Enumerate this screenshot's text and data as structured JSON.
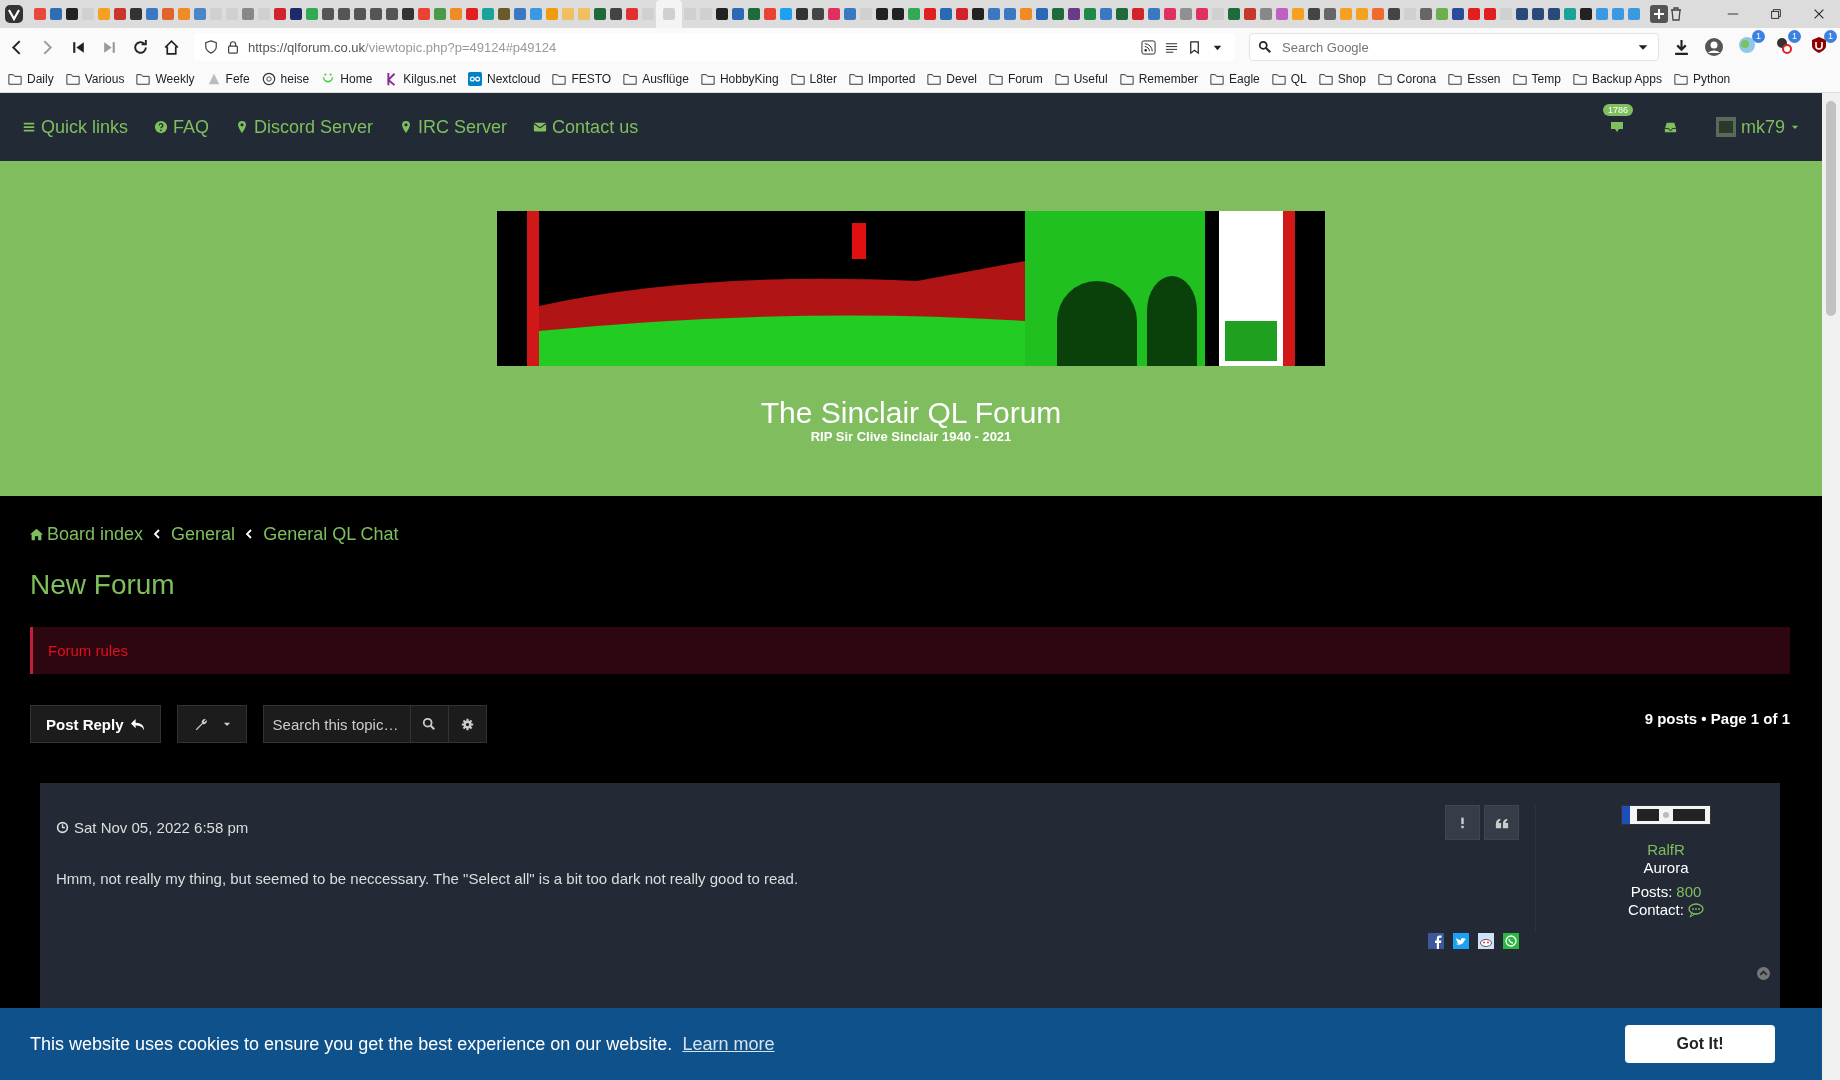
{
  "browser": {
    "tabs": [
      {
        "selected": false,
        "color": "#e8483c"
      },
      {
        "selected": false,
        "color": "#2f6db5"
      },
      {
        "selected": false,
        "color": "#222222"
      },
      {
        "selected": false,
        "color": "#d0d0d0"
      },
      {
        "selected": false,
        "color": "#f4a020"
      },
      {
        "selected": false,
        "color": "#c8352a"
      },
      {
        "selected": false,
        "color": "#333333"
      },
      {
        "selected": false,
        "color": "#3a78c2"
      },
      {
        "selected": false,
        "color": "#e2632a"
      },
      {
        "selected": false,
        "color": "#f08a24"
      },
      {
        "selected": false,
        "color": "#4a86c8"
      },
      {
        "selected": false,
        "color": "#d0d0d0"
      },
      {
        "selected": false,
        "color": "#d0d0d0"
      },
      {
        "selected": false,
        "color": "#888888"
      },
      {
        "selected": false,
        "color": "#d0d0d0"
      },
      {
        "selected": false,
        "color": "#d3232a"
      },
      {
        "selected": false,
        "color": "#1e2a6a"
      },
      {
        "selected": false,
        "color": "#34a853"
      },
      {
        "selected": false,
        "color": "#555555"
      },
      {
        "selected": false,
        "color": "#555555"
      },
      {
        "selected": false,
        "color": "#555555"
      },
      {
        "selected": false,
        "color": "#555555"
      },
      {
        "selected": false,
        "color": "#555555"
      },
      {
        "selected": false,
        "color": "#333333"
      },
      {
        "selected": false,
        "color": "#ea4335"
      },
      {
        "selected": false,
        "color": "#4a9a4a"
      },
      {
        "selected": false,
        "color": "#f08a24"
      },
      {
        "selected": false,
        "color": "#e02020"
      },
      {
        "selected": false,
        "color": "#1aa39a"
      },
      {
        "selected": false,
        "color": "#6a5a2a"
      },
      {
        "selected": false,
        "color": "#3a78c2"
      },
      {
        "selected": false,
        "color": "#3a9ae0"
      },
      {
        "selected": false,
        "color": "#f09a10"
      },
      {
        "selected": false,
        "color": "#f0c060"
      },
      {
        "selected": false,
        "color": "#f0c060"
      },
      {
        "selected": false,
        "color": "#1e6a3a"
      },
      {
        "selected": false,
        "color": "#444444"
      },
      {
        "selected": false,
        "color": "#e03030"
      },
      {
        "selected": false,
        "color": "#d0d0d0"
      },
      {
        "selected": true,
        "color": "#d0d0d0"
      },
      {
        "selected": false,
        "color": "#d0d0d0"
      },
      {
        "selected": false,
        "color": "#d0d0d0"
      },
      {
        "selected": false,
        "color": "#222222"
      },
      {
        "selected": false,
        "color": "#2a6ab5"
      },
      {
        "selected": false,
        "color": "#1e6a3a"
      },
      {
        "selected": false,
        "color": "#ea4335"
      },
      {
        "selected": false,
        "color": "#1da1f2"
      },
      {
        "selected": false,
        "color": "#333333"
      },
      {
        "selected": false,
        "color": "#444444"
      },
      {
        "selected": false,
        "color": "#e03060"
      },
      {
        "selected": false,
        "color": "#3a78c2"
      },
      {
        "selected": false,
        "color": "#d0d0d0"
      },
      {
        "selected": false,
        "color": "#222222"
      },
      {
        "selected": false,
        "color": "#222222"
      },
      {
        "selected": false,
        "color": "#34a853"
      },
      {
        "selected": false,
        "color": "#e02020"
      },
      {
        "selected": false,
        "color": "#2a6ab5"
      },
      {
        "selected": false,
        "color": "#d3232a"
      },
      {
        "selected": false,
        "color": "#222222"
      },
      {
        "selected": false,
        "color": "#3a78c2"
      },
      {
        "selected": false,
        "color": "#3a78c2"
      },
      {
        "selected": false,
        "color": "#f08a24"
      },
      {
        "selected": false,
        "color": "#2a6ab5"
      },
      {
        "selected": false,
        "color": "#1e6a3a"
      },
      {
        "selected": false,
        "color": "#6a3a8a"
      },
      {
        "selected": false,
        "color": "#1e8a4a"
      },
      {
        "selected": false,
        "color": "#3a78c2"
      },
      {
        "selected": false,
        "color": "#1e6a3a"
      },
      {
        "selected": false,
        "color": "#d3232a"
      },
      {
        "selected": false,
        "color": "#3a78c2"
      },
      {
        "selected": false,
        "color": "#e03060"
      },
      {
        "selected": false,
        "color": "#909090"
      },
      {
        "selected": false,
        "color": "#e03060"
      },
      {
        "selected": false,
        "color": "#d0d0d0"
      },
      {
        "selected": false,
        "color": "#1e6a3a"
      },
      {
        "selected": false,
        "color": "#c8352a"
      },
      {
        "selected": false,
        "color": "#888888"
      },
      {
        "selected": false,
        "color": "#c060c0"
      },
      {
        "selected": false,
        "color": "#f4a020"
      },
      {
        "selected": false,
        "color": "#444444"
      },
      {
        "selected": false,
        "color": "#666666"
      },
      {
        "selected": false,
        "color": "#f4a020"
      },
      {
        "selected": false,
        "color": "#f4a020"
      },
      {
        "selected": false,
        "color": "#f06a30"
      },
      {
        "selected": false,
        "color": "#444444"
      },
      {
        "selected": false,
        "color": "#d0d0d0"
      },
      {
        "selected": false,
        "color": "#666666"
      },
      {
        "selected": false,
        "color": "#6ab04c"
      },
      {
        "selected": false,
        "color": "#2a4a9a"
      },
      {
        "selected": false,
        "color": "#e02020"
      },
      {
        "selected": false,
        "color": "#e02020"
      },
      {
        "selected": false,
        "color": "#d0d0d0"
      },
      {
        "selected": false,
        "color": "#2a4a7a"
      },
      {
        "selected": false,
        "color": "#2a4a7a"
      },
      {
        "selected": false,
        "color": "#2a4a7a"
      },
      {
        "selected": false,
        "color": "#1aa39a"
      },
      {
        "selected": false,
        "color": "#222222"
      },
      {
        "selected": false,
        "color": "#3a9ae0"
      },
      {
        "selected": false,
        "color": "#3a9ae0"
      },
      {
        "selected": false,
        "color": "#3a9ae0"
      }
    ],
    "url_host": "https://qlforum.co.uk",
    "url_path": "/viewtopic.php?p=49124#p49124",
    "search": {
      "placeholder": "Search Google"
    },
    "extensions": [
      {
        "kind": "globe",
        "badge": "1"
      },
      {
        "kind": "blocker",
        "badge": "1"
      },
      {
        "kind": "shield",
        "badge": "1"
      }
    ],
    "bookmarks": [
      {
        "label": "Daily",
        "kind": "folder"
      },
      {
        "label": "Various",
        "kind": "folder"
      },
      {
        "label": "Weekly",
        "kind": "folder"
      },
      {
        "label": "Fefe",
        "kind": "triangle"
      },
      {
        "label": "heise",
        "kind": "at"
      },
      {
        "label": "Home",
        "kind": "smile"
      },
      {
        "label": "Kilgus.net",
        "kind": "letter"
      },
      {
        "label": "Nextcloud",
        "kind": "cloud"
      },
      {
        "label": "FESTO",
        "kind": "folder"
      },
      {
        "label": "Ausflüge",
        "kind": "folder"
      },
      {
        "label": "HobbyKing",
        "kind": "folder"
      },
      {
        "label": "L8ter",
        "kind": "folder"
      },
      {
        "label": "Imported",
        "kind": "folder"
      },
      {
        "label": "Devel",
        "kind": "folder"
      },
      {
        "label": "Forum",
        "kind": "folder"
      },
      {
        "label": "Useful",
        "kind": "folder"
      },
      {
        "label": "Remember",
        "kind": "folder"
      },
      {
        "label": "Eagle",
        "kind": "folder"
      },
      {
        "label": "QL",
        "kind": "folder"
      },
      {
        "label": "Shop",
        "kind": "folder"
      },
      {
        "label": "Corona",
        "kind": "folder"
      },
      {
        "label": "Essen",
        "kind": "folder"
      },
      {
        "label": "Temp",
        "kind": "folder"
      },
      {
        "label": "Backup Apps",
        "kind": "folder"
      },
      {
        "label": "Python",
        "kind": "folder"
      }
    ]
  },
  "nav": {
    "links": [
      {
        "label": "Quick links",
        "kind": "menu"
      },
      {
        "label": "FAQ",
        "kind": "help"
      },
      {
        "label": "Discord Server",
        "kind": "location"
      },
      {
        "label": "IRC Server",
        "kind": "location"
      },
      {
        "label": "Contact us",
        "kind": "mail"
      }
    ],
    "notifications_badge": "1786",
    "user": "mk79"
  },
  "banner": {
    "title": "The Sinclair QL Forum",
    "subtitle": "RIP Sir Clive Sinclair 1940 - 2021"
  },
  "breadcrumbs": [
    "Board index",
    "General",
    "General QL Chat"
  ],
  "topic_title": "New Forum",
  "forum_rules": "Forum rules",
  "actions": {
    "post_reply": "Post Reply",
    "search": {
      "placeholder": "Search this topic…"
    }
  },
  "pagination": "9 posts • Page 1 of 1",
  "post": {
    "date": "Sat Nov 05, 2022 6:58 pm",
    "body": "Hmm, not really my thing, but seemed to be neccessary. The \"Select all\" is a bit too dark not really good to read.",
    "author": {
      "username": "RalfR",
      "rank": "Aurora",
      "posts_label": "Posts:",
      "posts": "800",
      "contact_label": "Contact:"
    },
    "share": [
      {
        "kind": "facebook"
      },
      {
        "kind": "twitter"
      },
      {
        "kind": "reddit"
      },
      {
        "kind": "whatsapp"
      }
    ]
  },
  "cookie": {
    "message": "This website uses cookies to ensure you get the best experience on our website.",
    "link": "Learn more",
    "button": "Got It!"
  }
}
